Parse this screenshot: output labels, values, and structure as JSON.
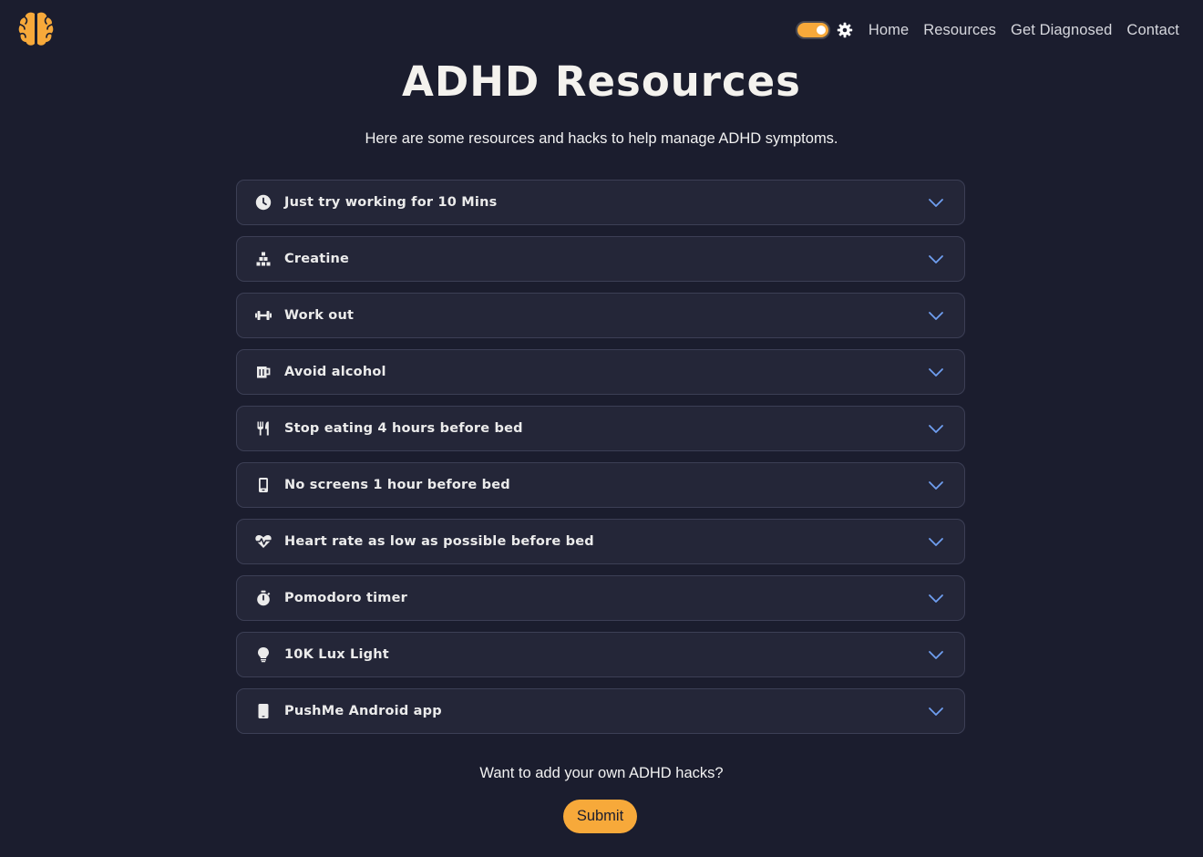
{
  "header": {
    "logo_icon": "brain-icon",
    "theme_toggle_icon": "toggle-switch-icon",
    "settings_icon": "gear-icon",
    "nav": [
      {
        "label": "Home"
      },
      {
        "label": "Resources"
      },
      {
        "label": "Get Diagnosed"
      },
      {
        "label": "Contact"
      }
    ]
  },
  "main": {
    "title": "ADHD Resources",
    "subtitle": "Here are some resources and hacks to help manage ADHD symptoms.",
    "items": [
      {
        "label": "Just try working for 10 Mins",
        "icon": "clock-icon"
      },
      {
        "label": "Creatine",
        "icon": "cubes-icon"
      },
      {
        "label": "Work out",
        "icon": "dumbbell-icon"
      },
      {
        "label": "Avoid alcohol",
        "icon": "beer-mug-icon"
      },
      {
        "label": "Stop eating 4 hours before bed",
        "icon": "utensils-icon"
      },
      {
        "label": "No screens 1 hour before bed",
        "icon": "mobile-phone-icon"
      },
      {
        "label": "Heart rate as low as possible before bed",
        "icon": "heart-pulse-icon"
      },
      {
        "label": "Pomodoro timer",
        "icon": "stopwatch-icon"
      },
      {
        "label": "10K Lux Light",
        "icon": "lightbulb-icon"
      },
      {
        "label": "PushMe Android app",
        "icon": "tablet-icon"
      }
    ],
    "expand_icon": "chevron-down-icon"
  },
  "footer": {
    "cta_text": "Want to add your own ADHD hacks?",
    "submit_label": "Submit"
  },
  "colors": {
    "background": "#1b1d2e",
    "card": "#242638",
    "card_border": "#3c3f55",
    "accent": "#f7a93a",
    "chevron": "#6f9ef0"
  }
}
